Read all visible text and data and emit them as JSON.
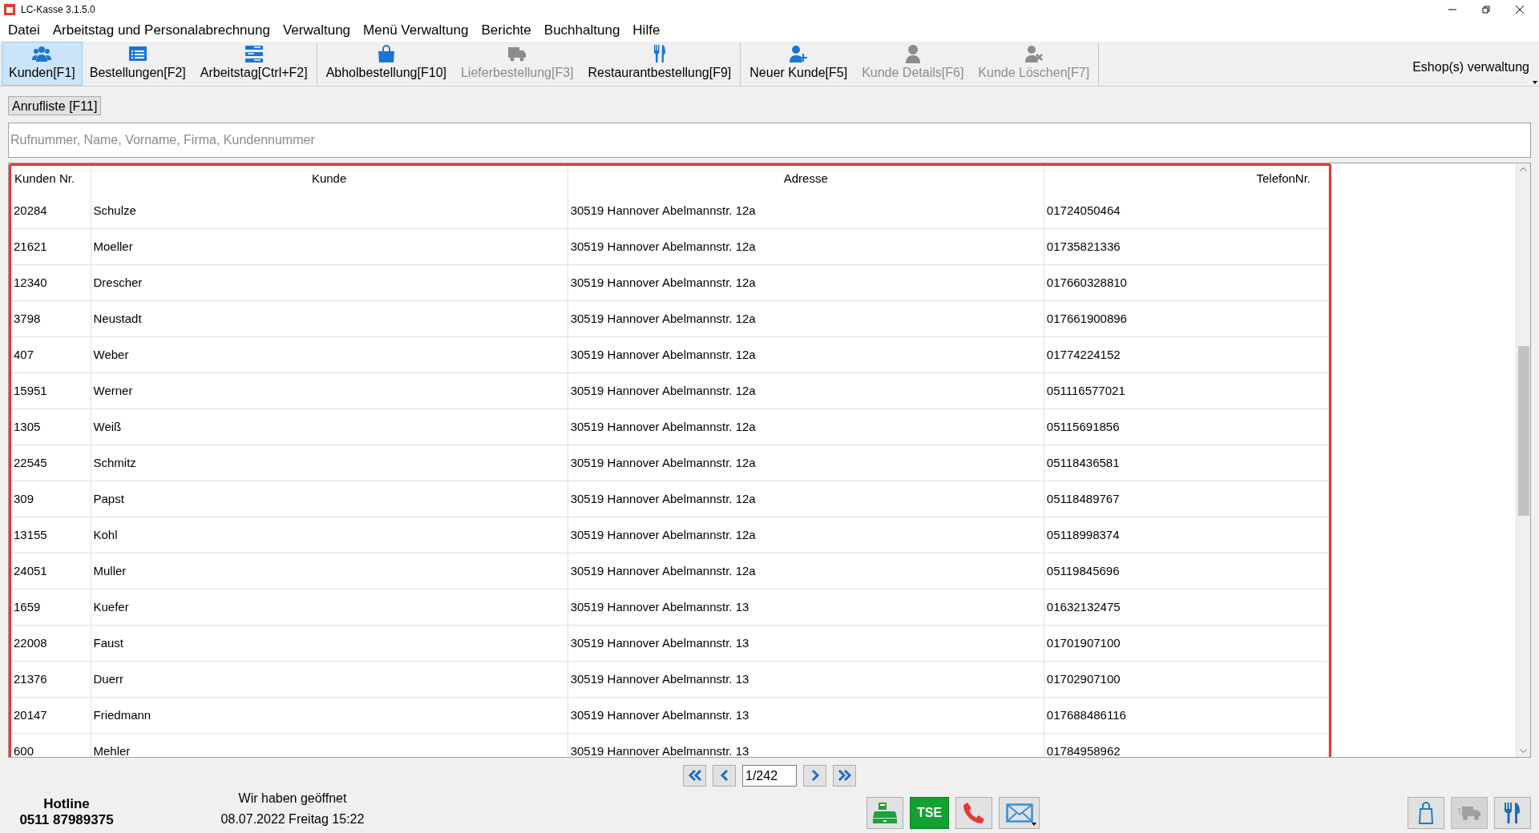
{
  "window": {
    "title": "LC-Kasse 3.1.5.0"
  },
  "menu": [
    "Datei",
    "Arbeitstag und Personalabrechnung",
    "Verwaltung",
    "Menü Verwaltung",
    "Berichte",
    "Buchhaltung",
    "Hilfe"
  ],
  "toolbar_groups": [
    [
      {
        "label": "Kunden[F1]",
        "kind": "users",
        "selected": true,
        "disabled": false
      },
      {
        "label": "Bestellungen[F2]",
        "kind": "list",
        "selected": false,
        "disabled": false
      },
      {
        "label": "Arbeitstag[Ctrl+F2]",
        "kind": "stack",
        "selected": false,
        "disabled": false
      }
    ],
    [
      {
        "label": "Abholbestellung[F10]",
        "kind": "bag",
        "selected": false,
        "disabled": false
      },
      {
        "label": "Lieferbestellung[F3]",
        "kind": "truck",
        "selected": false,
        "disabled": true
      },
      {
        "label": "Restaurantbestellung[F9]",
        "kind": "cutlery",
        "selected": false,
        "disabled": false
      }
    ],
    [
      {
        "label": "Neuer Kunde[F5]",
        "kind": "user-add",
        "selected": false,
        "disabled": false
      },
      {
        "label": "Kunde Details[F6]",
        "kind": "user",
        "selected": false,
        "disabled": true
      },
      {
        "label": "Kunde Löschen[F7]",
        "kind": "user-remove",
        "selected": false,
        "disabled": true
      }
    ]
  ],
  "eshop_menu": "Eshop(s) verwaltung",
  "call_list_button": "Anrufliste [F11]",
  "search": {
    "placeholder": "Rufnummer, Name, Vorname, Firma, Kundennummer"
  },
  "table": {
    "columns": [
      "Kunden Nr.",
      "Kunde",
      "Adresse",
      "TelefonNr."
    ],
    "rows": [
      [
        "20284",
        "Schulze",
        "30519 Hannover Abelmannstr. 12a",
        "01724050464"
      ],
      [
        "21621",
        "Moeller",
        "30519 Hannover Abelmannstr. 12a",
        "01735821336"
      ],
      [
        "12340",
        "Drescher",
        "30519 Hannover Abelmannstr. 12a",
        "017660328810"
      ],
      [
        "3798",
        "Neustadt",
        "30519 Hannover Abelmannstr. 12a",
        "017661900896"
      ],
      [
        "407",
        "Weber",
        "30519 Hannover Abelmannstr. 12a",
        "01774224152"
      ],
      [
        "15951",
        "Werner",
        "30519 Hannover Abelmannstr. 12a",
        "051116577021"
      ],
      [
        "1305",
        "Weiß",
        "30519 Hannover Abelmannstr. 12a",
        "05115691856"
      ],
      [
        "22545",
        "Schmitz",
        "30519 Hannover Abelmannstr. 12a",
        "05118436581"
      ],
      [
        "309",
        "Papst",
        "30519 Hannover Abelmannstr. 12a",
        "05118489767"
      ],
      [
        "13155",
        "Kohl",
        "30519 Hannover Abelmannstr. 12a",
        "05118998374"
      ],
      [
        "24051",
        "Muller",
        "30519 Hannover Abelmannstr. 12a",
        "05119845696"
      ],
      [
        "1659",
        "Kuefer",
        "30519 Hannover Abelmannstr. 13",
        "01632132475"
      ],
      [
        "22008",
        "Faust",
        "30519 Hannover Abelmannstr. 13",
        "01701907100"
      ],
      [
        "21376",
        "Duerr",
        "30519 Hannover Abelmannstr. 13",
        "01702907100"
      ],
      [
        "20147",
        "Friedmann",
        "30519 Hannover Abelmannstr. 13",
        "017688486116"
      ],
      [
        "600",
        "Mehler",
        "30519 Hannover Abelmannstr. 13",
        "01784958962"
      ]
    ]
  },
  "pagination": {
    "page": "1/242"
  },
  "footer": {
    "hotline_label": "Hotline",
    "hotline_number": "0511 87989375",
    "status": "Wir haben geöffnet",
    "datetime": "08.07.2022 Freitag 15:22",
    "center_buttons": [
      {
        "kind": "register"
      },
      {
        "kind": "tse",
        "label": "TSE"
      },
      {
        "kind": "phone"
      },
      {
        "kind": "mail"
      }
    ],
    "right_buttons": [
      {
        "kind": "bag",
        "disabled": false
      },
      {
        "kind": "truck",
        "disabled": true
      },
      {
        "kind": "cutlery",
        "disabled": false
      }
    ]
  }
}
